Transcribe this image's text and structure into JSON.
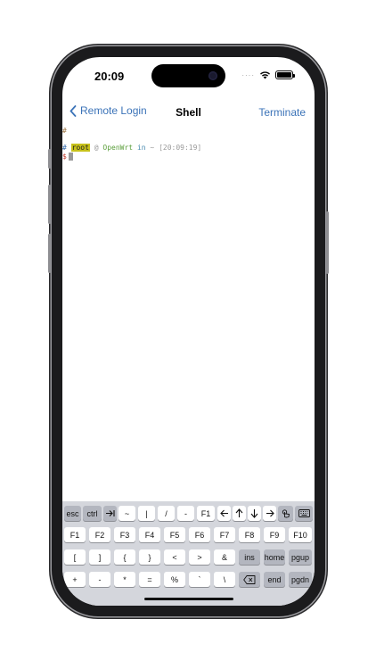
{
  "status": {
    "time": "20:09",
    "dots": "····"
  },
  "nav": {
    "back_label": "Remote Login",
    "title": "Shell",
    "right_label": "Terminate"
  },
  "terminal": {
    "line1": "#",
    "prompt_hash": "#",
    "user": "root",
    "at": "@",
    "host": "OpenWrt",
    "in_word": "in",
    "path": "~",
    "time": "[20:09:19]",
    "dollar": "$"
  },
  "keyboard": {
    "row0": [
      "esc",
      "ctrl",
      "tab-icon",
      "~",
      "|",
      "/",
      "-",
      "F1",
      "left-arrow-icon",
      "up-arrow-icon",
      "down-arrow-icon",
      "right-arrow-icon",
      "touch-icon",
      "keyboard-icon"
    ],
    "row1": [
      "F1",
      "F2",
      "F3",
      "F4",
      "F5",
      "F6",
      "F7",
      "F8",
      "F9",
      "F10"
    ],
    "row2": [
      "[",
      "]",
      "{",
      "}",
      "<",
      ">",
      "&",
      "ins",
      "home",
      "pgup"
    ],
    "row3": [
      "+",
      "-",
      "*",
      "=",
      "%",
      "`",
      "\\",
      "delete-icon",
      "end",
      "pgdn"
    ]
  },
  "labels": {
    "esc": "esc",
    "ctrl": "ctrl",
    "tilde": "~",
    "pipe": "|",
    "slash": "/",
    "dash": "-",
    "f1_top": "F1",
    "f1": "F1",
    "f2": "F2",
    "f3": "F3",
    "f4": "F4",
    "f5": "F5",
    "f6": "F6",
    "f7": "F7",
    "f8": "F8",
    "f9": "F9",
    "f10": "F10",
    "lbracket": "[",
    "rbracket": "]",
    "lbrace": "{",
    "rbrace": "}",
    "lt": "<",
    "gt": ">",
    "amp": "&",
    "ins": "ins",
    "home": "home",
    "pgup": "pgup",
    "plus": "+",
    "minus": "-",
    "star": "*",
    "equals": "=",
    "percent": "%",
    "backtick": "`",
    "backslash": "\\",
    "end": "end",
    "pgdn": "pgdn"
  },
  "colors": {
    "accent": "#3b73b8",
    "user_highlight": "#c7c11b",
    "keyboard_bg": "#d4d6dc"
  }
}
